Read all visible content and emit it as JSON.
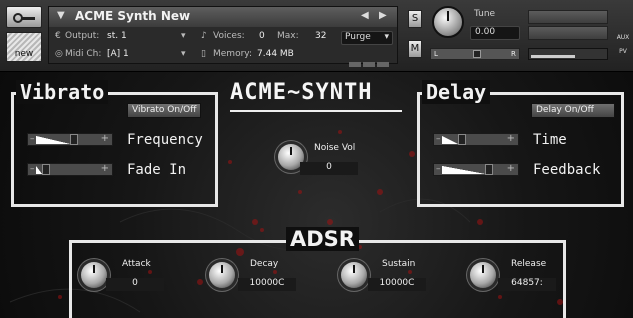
{
  "header": {
    "instrument_name": "ACME Synth New",
    "new_label": "new",
    "output_label": "Output:",
    "output_value": "st. 1",
    "voices_label": "Voices:",
    "voices_value": "0",
    "max_label": "Max:",
    "max_value": "32",
    "purge_label": "Purge",
    "midi_label": "Midi Ch:",
    "midi_value": "[A]  1",
    "memory_label": "Memory:",
    "memory_value": "7.44 MB",
    "solo_label": "S",
    "mute_label": "M",
    "tune_label": "Tune",
    "tune_value": "0.00",
    "pan_left": "L",
    "pan_right": "R",
    "aux_label": "AUX",
    "pv_label": "PV"
  },
  "logo": "ACME~SYNTH",
  "vibrato": {
    "title": "Vibrato",
    "toggle_label": "Vibrato On/Off",
    "frequency_label": "Frequency",
    "fade_in_label": "Fade In",
    "frequency_level": 0.55,
    "fade_in_level": 0.1
  },
  "noise": {
    "label": "Noise Vol",
    "value": "0"
  },
  "delay": {
    "title": "Delay",
    "toggle_label": "Delay On/Off",
    "time_label": "Time",
    "feedback_label": "Feedback",
    "time_level": 0.25,
    "feedback_level": 0.7
  },
  "adsr": {
    "title": "ADSR",
    "attack_label": "Attack",
    "attack_value": "0",
    "decay_label": "Decay",
    "decay_value": "10000C",
    "sustain_label": "Sustain",
    "sustain_value": "10000C",
    "release_label": "Release",
    "release_value": "64857:"
  },
  "colors": {
    "accent_red": "#b01010",
    "panel_border": "#e8e8e8"
  }
}
